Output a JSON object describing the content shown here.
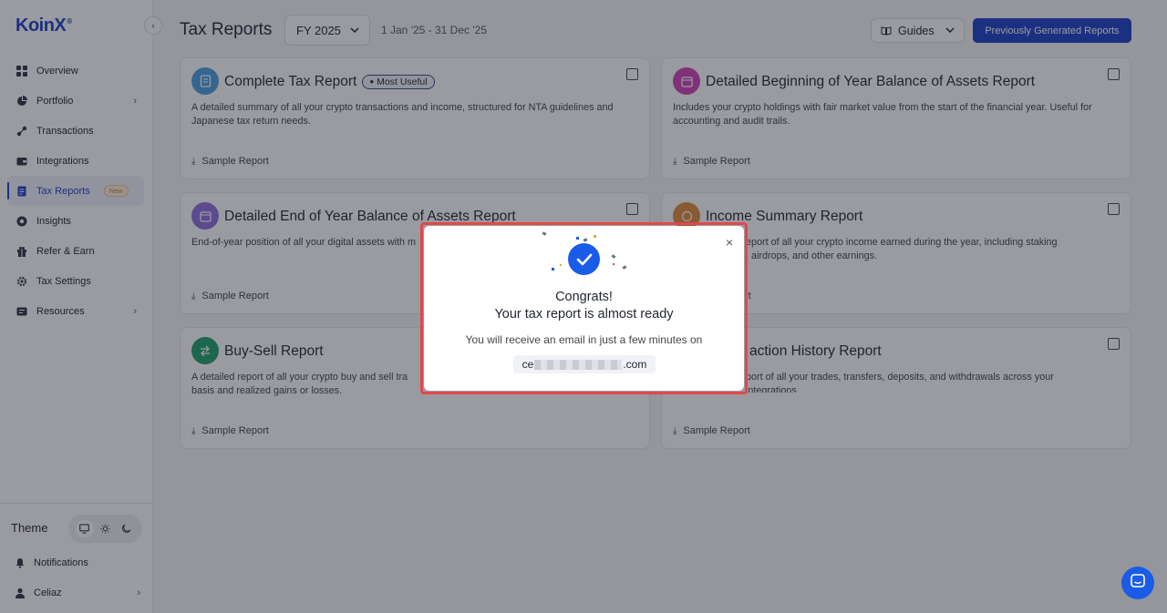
{
  "brand": {
    "logo_text": "KoinX",
    "logo_mark": "®"
  },
  "sidebar": {
    "collapse_icon": "‹",
    "items": [
      {
        "label": "Overview",
        "icon": "grid-icon"
      },
      {
        "label": "Portfolio",
        "icon": "pie-icon",
        "chevron": "›"
      },
      {
        "label": "Transactions",
        "icon": "transfer-icon"
      },
      {
        "label": "Integrations",
        "icon": "wallet-icon"
      },
      {
        "label": "Tax Reports",
        "icon": "doc-icon",
        "badge": "New",
        "active": true
      },
      {
        "label": "Insights",
        "icon": "insight-icon"
      },
      {
        "label": "Refer & Earn",
        "icon": "gift-icon"
      },
      {
        "label": "Tax Settings",
        "icon": "gear-icon"
      },
      {
        "label": "Resources",
        "icon": "resources-icon",
        "chevron": "›"
      }
    ],
    "theme_label": "Theme",
    "theme_options": [
      "monitor-icon",
      "sun-icon",
      "moon-icon"
    ],
    "notifications_label": "Notifications",
    "user_label": "Celiaz",
    "user_chevron": "›"
  },
  "header": {
    "title": "Tax Reports",
    "fy_value": "FY 2025",
    "date_range": "1 Jan '25 - 31 Dec '25",
    "guides_label": "Guides",
    "previous_reports_label": "Previously Generated Reports"
  },
  "cards": [
    {
      "title": "Complete Tax Report",
      "badge": "Most Useful",
      "desc": "A detailed summary of all your crypto transactions and income, structured for NTA guidelines and Japanese tax return needs.",
      "sample": "Sample Report",
      "color": "#4a9fe0"
    },
    {
      "title": "Detailed Beginning of Year Balance of Assets Report",
      "desc": "Includes your crypto holdings with fair market value from the start of the financial year. Useful for accounting and audit trails.",
      "sample": "Sample Report",
      "color": "#d23fb7"
    },
    {
      "title": "Detailed End of Year Balance of Assets Report",
      "desc": "End-of-year position of all your digital assets with m",
      "sample": "Sample Report",
      "color": "#8e6ce0"
    },
    {
      "title": "Income Summary Report",
      "desc": "eport of all your crypto income earned during the year, including staking\n, airdrops, and other earnings.",
      "sample": "rt",
      "color": "#e08a3a"
    },
    {
      "title": "Buy-Sell Report",
      "desc": "A detailed report of all your crypto buy and sell tra\nbasis and realized gains or losses.",
      "sample": "Sample Report",
      "color": "#1f9e6b"
    },
    {
      "title": "action History Report",
      "desc": "port of all your trades, transfers, deposits, and withdrawals across your\nintegrations",
      "sample": "Sample Report",
      "color": "#3a7be0"
    }
  ],
  "modal": {
    "close": "×",
    "heading": "Congrats!",
    "subheading": "Your tax report is almost ready",
    "body": "You will receive an email in just a few minutes on",
    "email_prefix": "ce",
    "email_suffix": ".com"
  }
}
